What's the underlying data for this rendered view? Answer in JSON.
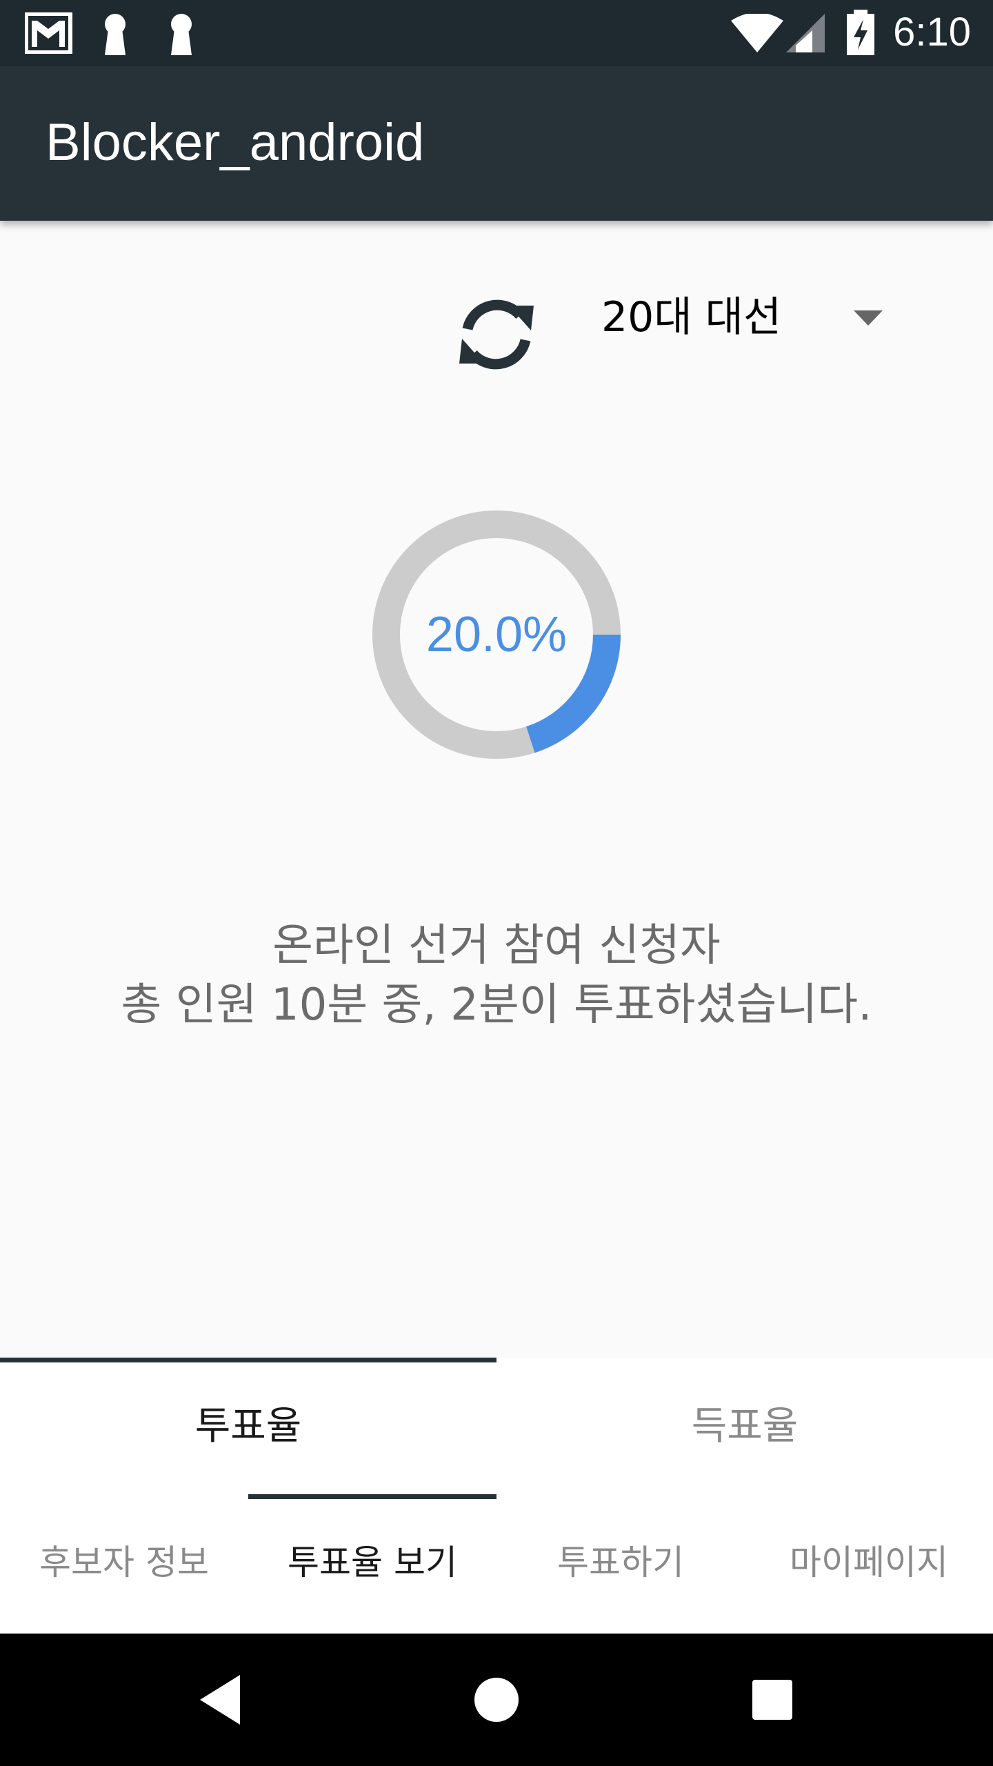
{
  "status_bar": {
    "time": "6:10",
    "left_icons": [
      "gmail-icon",
      "keyhole-icon",
      "keyhole-icon"
    ],
    "right_icons": [
      "wifi-icon",
      "cell-signal-icon",
      "battery-charging-icon"
    ]
  },
  "app_bar": {
    "title": "Blocker_android"
  },
  "selector": {
    "value": "20대 대선",
    "refresh_icon": "refresh-icon",
    "dropdown_icon": "dropdown-arrow-icon"
  },
  "turnout": {
    "percent_label": "20.0%",
    "fraction": 0.2
  },
  "summary": {
    "line1": "온라인 선거 참여 신청자",
    "line2": "총 인원 10분 중, 2분이 투표하셨습니다."
  },
  "tabs": [
    {
      "label": "투표율",
      "selected": true
    },
    {
      "label": "득표율",
      "selected": false
    }
  ],
  "bottom_nav": [
    {
      "label": "후보자 정보",
      "selected": false
    },
    {
      "label": "투표율 보기",
      "selected": true
    },
    {
      "label": "투표하기",
      "selected": false
    },
    {
      "label": "마이페이지",
      "selected": false
    }
  ],
  "system_nav": [
    "back-icon",
    "home-icon",
    "recents-icon"
  ],
  "colors": {
    "app_bar": "#263238",
    "status_bar": "#1f2a30",
    "accent_blue": "#4a8fe3",
    "track_gray": "#cccccc",
    "selected_text": "#1a1a1a",
    "unselected_text": "#8a8a8a"
  }
}
